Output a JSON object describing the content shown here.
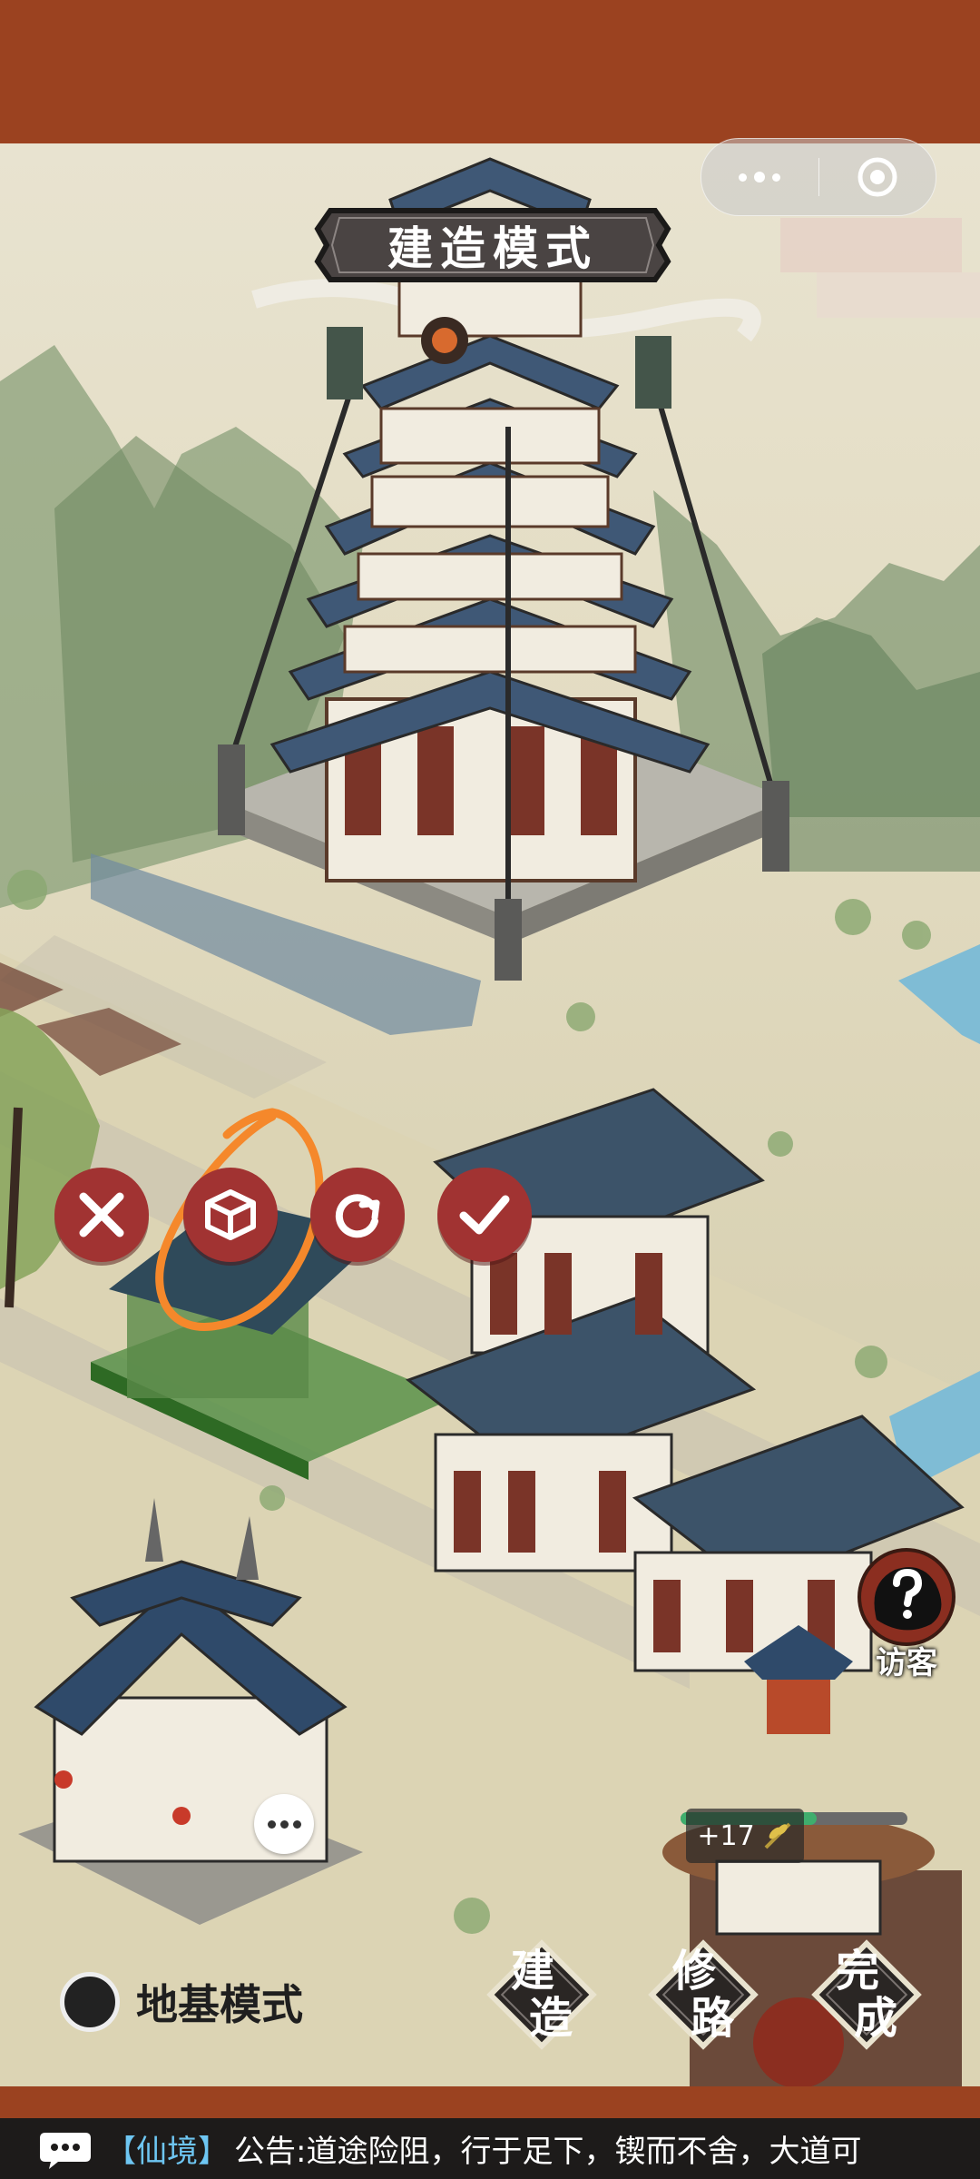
{
  "header": {
    "title": "建造模式"
  },
  "capsule": {
    "more_icon": "more-dots-icon",
    "close_icon": "target-circle-icon"
  },
  "build_actions": [
    {
      "name": "cancel",
      "icon": "x-icon"
    },
    {
      "name": "store",
      "icon": "box-icon"
    },
    {
      "name": "rotate",
      "icon": "rotate-icon"
    },
    {
      "name": "confirm",
      "icon": "check-icon"
    }
  ],
  "visitor": {
    "label": "访客",
    "icon": "question-mark-icon"
  },
  "reward": {
    "value": "+17",
    "icon": "wheat-icon",
    "progress": 0.6
  },
  "foundation_toggle": {
    "label": "地基模式"
  },
  "buttons": {
    "build": "建造",
    "repair": "修路",
    "finish": "完成"
  },
  "notice": {
    "tag": "【仙境】",
    "text": "公告:道途险阻，行于足下，锲而不舍，大道可"
  },
  "colors": {
    "bar": "#9b4220",
    "button_red": "#a13332",
    "annotation": "#f5882b"
  }
}
